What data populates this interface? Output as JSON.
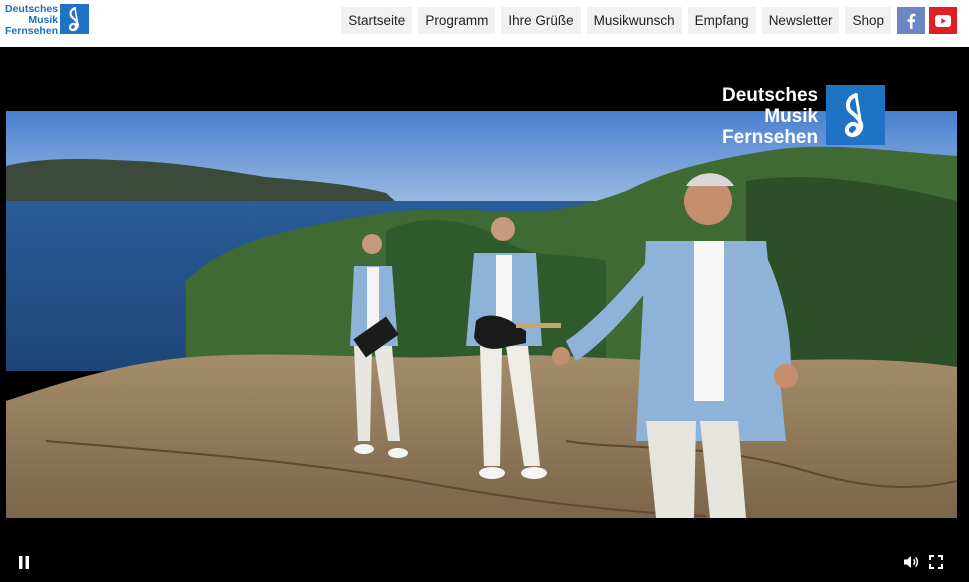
{
  "header": {
    "logo": {
      "line1": "Deutsches",
      "line2": "Musik",
      "line3": "Fernsehen"
    },
    "nav": [
      {
        "label": "Startseite"
      },
      {
        "label": "Programm"
      },
      {
        "label": "Ihre Grüße"
      },
      {
        "label": "Musikwunsch"
      },
      {
        "label": "Empfang"
      },
      {
        "label": "Newsletter"
      },
      {
        "label": "Shop"
      }
    ],
    "social": {
      "facebook": "facebook-icon",
      "youtube": "youtube-icon"
    }
  },
  "video": {
    "watermark": {
      "line1": "Deutsches",
      "line2": "Musik",
      "line3": "Fernsehen"
    },
    "state": "playing"
  },
  "colors": {
    "brand_blue": "#1f72c4",
    "facebook": "#6c86c4",
    "youtube": "#e02020"
  }
}
